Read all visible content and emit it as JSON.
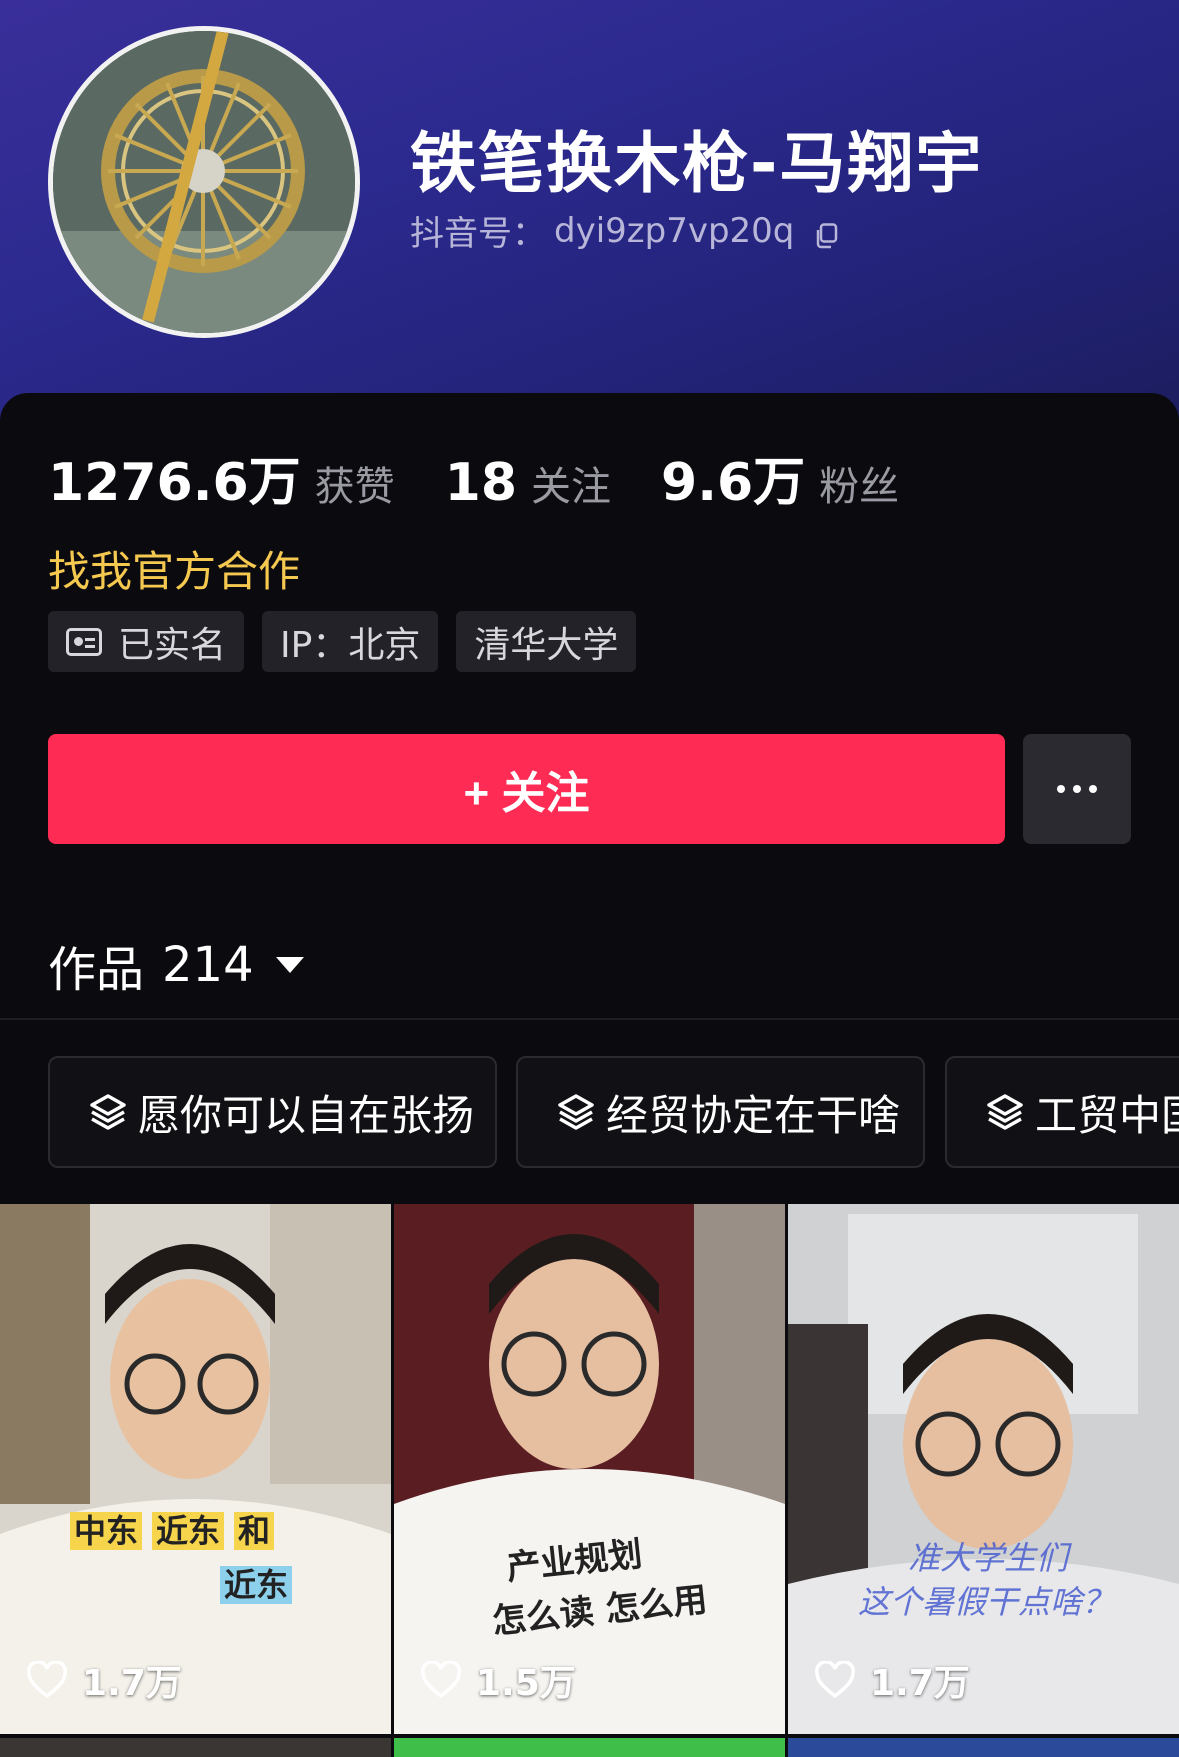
{
  "profile": {
    "name": "铁笔换木枪-马翔宇",
    "douyin_id_label": "抖音号：",
    "douyin_id": "dyi9zp7vp20q"
  },
  "stats": [
    {
      "value": "1276.6万",
      "label": "获赞"
    },
    {
      "value": "18",
      "label": "关注"
    },
    {
      "value": "9.6万",
      "label": "粉丝"
    }
  ],
  "cooperate_link": "找我官方合作",
  "tags": [
    {
      "icon": "id-card-icon",
      "label": "已实名"
    },
    {
      "icon": "",
      "label": "IP：北京"
    },
    {
      "icon": "",
      "label": "清华大学"
    }
  ],
  "actions": {
    "follow_label": "+ 关注",
    "more_icon": "more-dots-icon"
  },
  "works": {
    "label": "作品",
    "count": "214"
  },
  "collections": [
    {
      "icon": "layers-icon",
      "label": "愿你可以自在张扬"
    },
    {
      "icon": "layers-icon",
      "label": "经贸协定在干啥"
    },
    {
      "icon": "layers-icon",
      "label": "工贸中国"
    }
  ],
  "videos": [
    {
      "likes": "1.7万",
      "caption_lines": [
        "中东",
        "近东",
        "和",
        "近东"
      ]
    },
    {
      "likes": "1.5万",
      "caption_lines": [
        "产业规划",
        "怎么读 怎么用"
      ]
    },
    {
      "likes": "1.7万",
      "caption_lines": [
        "准大学生们",
        "这个暑假干点啥？"
      ]
    }
  ],
  "colors": {
    "accent": "#fe2c55",
    "cooperate": "#f5c850",
    "background": "#0b0b0f"
  }
}
